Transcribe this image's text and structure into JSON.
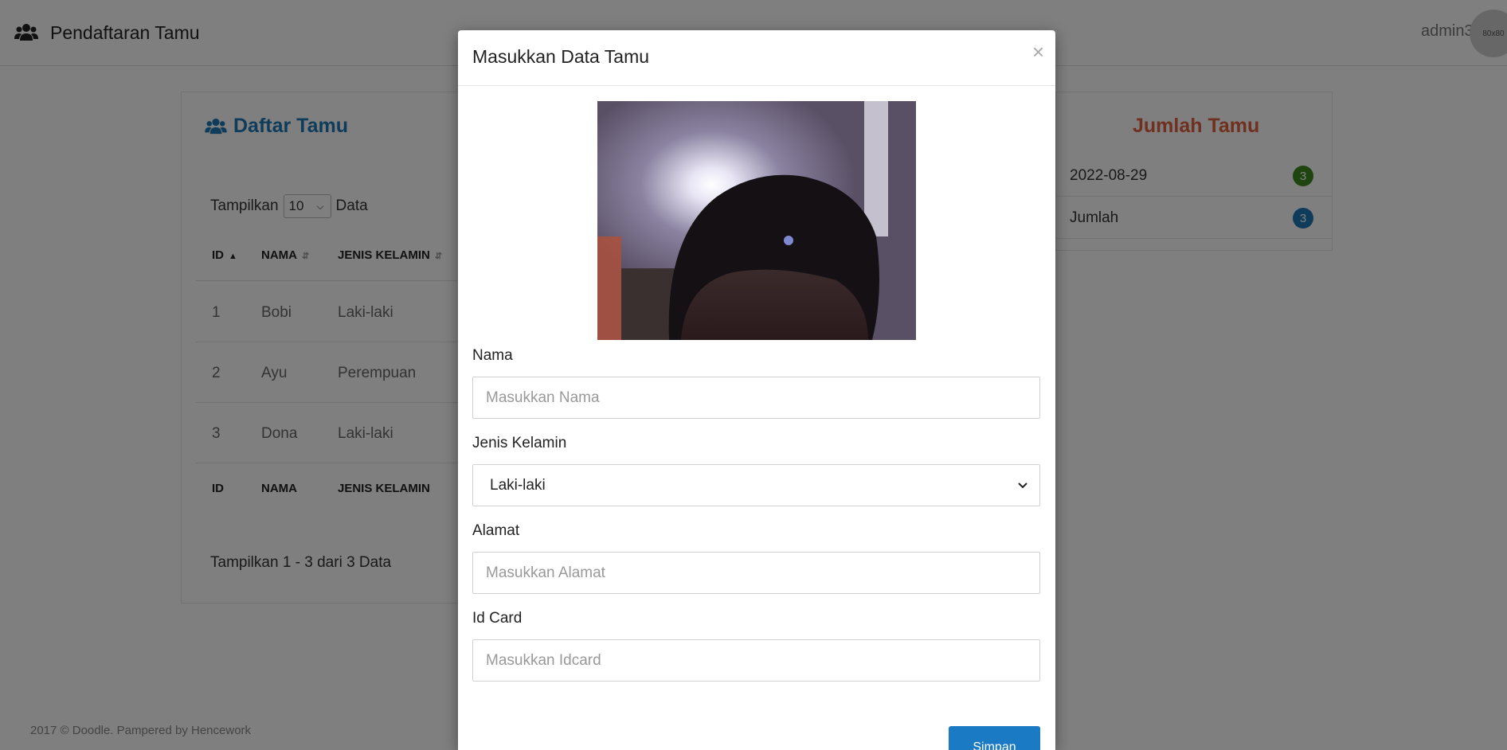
{
  "header": {
    "brand_title": "Pendaftaran Tamu",
    "brand_icon": "users-icon",
    "user_name": "admin3",
    "avatar_text": "80x80"
  },
  "guest_list": {
    "title": "Daftar Tamu",
    "show_label": "Tampilkan",
    "page_size": "10",
    "show_suffix": "Data",
    "columns": [
      "ID",
      "NAMA",
      "JENIS KELAMIN"
    ],
    "rows": [
      {
        "id": "1",
        "nama": "Bobi",
        "jenis_kelamin": "Laki-laki"
      },
      {
        "id": "2",
        "nama": "Ayu",
        "jenis_kelamin": "Perempuan"
      },
      {
        "id": "3",
        "nama": "Dona",
        "jenis_kelamin": "Laki-laki"
      }
    ],
    "info": "Tampilkan 1 - 3 dari 3 Data"
  },
  "guest_count": {
    "title": "Jumlah Tamu",
    "items": [
      {
        "label": "2022-08-29",
        "count": "3",
        "color": "#3d8b1e"
      },
      {
        "label": "Jumlah",
        "count": "3",
        "color": "#1f78b4"
      }
    ]
  },
  "footer": {
    "text": "2017 © Doodle. Pampered by Hencework"
  },
  "modal": {
    "title": "Masukkan Data Tamu",
    "close_symbol": "×",
    "fields": {
      "nama": {
        "label": "Nama",
        "placeholder": "Masukkan Nama"
      },
      "jenis_kelamin": {
        "label": "Jenis Kelamin",
        "value": "Laki-laki"
      },
      "alamat": {
        "label": "Alamat",
        "placeholder": "Masukkan Alamat"
      },
      "id_card": {
        "label": "Id Card",
        "placeholder": "Masukkan Idcard"
      }
    },
    "submit_label": "Simpan"
  },
  "colors": {
    "primary": "#1a7bc4",
    "count_title": "#e0613f",
    "list_title": "#1f78b4"
  }
}
